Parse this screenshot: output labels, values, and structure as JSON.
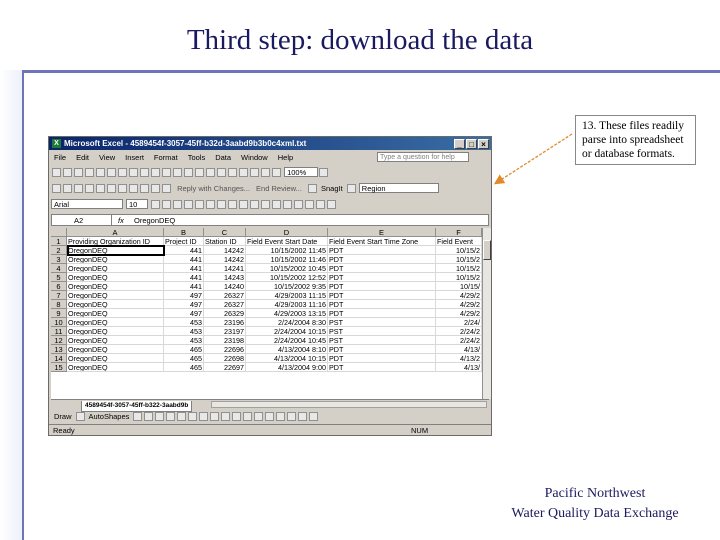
{
  "slide": {
    "title": "Third step: download the data",
    "callout": "13. These files readily parse into spreadsheet or database formats.",
    "footer_line1": "Pacific Northwest",
    "footer_line2": "Water Quality Data Exchange"
  },
  "excel": {
    "title": "Microsoft Excel - 4589454f-3057-45ff-b32d-3aabd9b3b0c4xml.txt",
    "menu": [
      "File",
      "Edit",
      "View",
      "Insert",
      "Format",
      "Tools",
      "Data",
      "Window",
      "Help"
    ],
    "help_placeholder": "Type a question for help",
    "toolbar2_text1": "Reply with Changes...",
    "toolbar2_text2": "End Review...",
    "snagit": "SnagIt",
    "region": "Region",
    "zoom": "100%",
    "font": "Arial",
    "font_size": "10",
    "name_box": "A2",
    "fx": "fx",
    "formula_value": "OregonDEQ",
    "columns": [
      "A",
      "B",
      "C",
      "D",
      "E",
      "F"
    ],
    "header_row": [
      "Providing Organization ID",
      "Project ID",
      "Station ID",
      "Field Event Start Date",
      "Field Event Start Time Zone",
      "Field Event"
    ],
    "rows": [
      [
        "OregonDEQ",
        "441",
        "14242",
        "10/15/2002 11:45",
        "PDT",
        "10/15/2"
      ],
      [
        "OregonDEQ",
        "441",
        "14242",
        "10/15/2002 11:46",
        "PDT",
        "10/15/2"
      ],
      [
        "OregonDEQ",
        "441",
        "14241",
        "10/15/2002 10:45",
        "PDT",
        "10/15/2"
      ],
      [
        "OregonDEQ",
        "441",
        "14243",
        "10/15/2002 12:52",
        "PDT",
        "10/15/2"
      ],
      [
        "OregonDEQ",
        "441",
        "14240",
        "10/15/2002 9:35",
        "PDT",
        "10/15/"
      ],
      [
        "OregonDEQ",
        "497",
        "26327",
        "4/29/2003 11:15",
        "PDT",
        "4/29/2"
      ],
      [
        "OregonDEQ",
        "497",
        "26327",
        "4/29/2003 11:16",
        "PDT",
        "4/29/2"
      ],
      [
        "OregonDEQ",
        "497",
        "26329",
        "4/29/2003 13:15",
        "PDT",
        "4/29/2"
      ],
      [
        "OregonDEQ",
        "453",
        "23196",
        "2/24/2004 8:30",
        "PST",
        "2/24/"
      ],
      [
        "OregonDEQ",
        "453",
        "23197",
        "2/24/2004 10:15",
        "PST",
        "2/24/2"
      ],
      [
        "OregonDEQ",
        "453",
        "23198",
        "2/24/2004 10:45",
        "PST",
        "2/24/2"
      ],
      [
        "OregonDEQ",
        "465",
        "22696",
        "4/13/2004 8:10",
        "PDT",
        "4/13/"
      ],
      [
        "OregonDEQ",
        "465",
        "22698",
        "4/13/2004 10:15",
        "PDT",
        "4/13/2"
      ],
      [
        "OregonDEQ",
        "465",
        "22697",
        "4/13/2004 9:00",
        "PDT",
        "4/13/"
      ]
    ],
    "sheet_tab": "4589454f-3057-45ff-b322-3aabd9b",
    "draw_label": "Draw",
    "autoshapes_label": "AutoShapes",
    "status_left": "Ready",
    "status_num": "NUM"
  }
}
